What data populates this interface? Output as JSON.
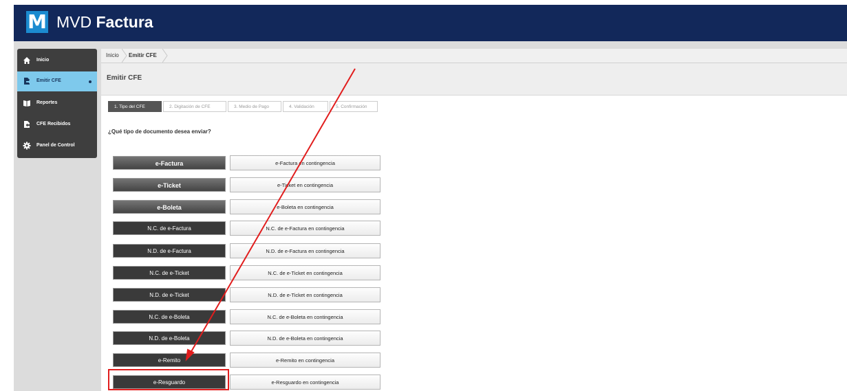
{
  "header": {
    "logo_letter": "M",
    "brand_light": "MVD ",
    "brand_bold": "Factura"
  },
  "sidebar": {
    "items": [
      {
        "label": "Inicio",
        "icon": "home-icon"
      },
      {
        "label": "Emitir CFE",
        "icon": "document-send-icon",
        "active": true
      },
      {
        "label": "Reportes",
        "icon": "book-icon"
      },
      {
        "label": "CFE Recibidos",
        "icon": "document-receive-icon"
      },
      {
        "label": "Panel de Control",
        "icon": "gear-icon"
      }
    ]
  },
  "breadcrumb": {
    "items": [
      "Inicio",
      "Emitir CFE"
    ]
  },
  "page": {
    "title": "Emitir CFE",
    "question": "¿Qué tipo de documento desea enviar?"
  },
  "steps": [
    "1. Tipo del CFE",
    "2. Digitación de CFE",
    "3. Medio de Pago",
    "4. Validación",
    "5. Confirmación"
  ],
  "documents": [
    {
      "type": "e-Factura",
      "contingency": "e-Factura en contingencia"
    },
    {
      "type": "e-Ticket",
      "contingency": "e-Ticket en contingencia"
    },
    {
      "type": "e-Boleta",
      "contingency": "e-Boleta en contingencia"
    },
    {
      "type": "N.C. de e-Factura",
      "contingency": "N.C. de e-Factura en contingencia"
    },
    {
      "type": "N.D. de e-Factura",
      "contingency": "N.D. de e-Factura en contingencia"
    },
    {
      "type": "N.C. de e-Ticket",
      "contingency": "N.C. de e-Ticket en contingencia"
    },
    {
      "type": "N.D. de e-Ticket",
      "contingency": "N.D. de e-Ticket en contingencia"
    },
    {
      "type": "N.C. de e-Boleta",
      "contingency": "N.C. de e-Boleta en contingencia"
    },
    {
      "type": "N.D. de e-Boleta",
      "contingency": "N.D. de e-Boleta en contingencia"
    },
    {
      "type": "e-Remito",
      "contingency": "e-Remito en contingencia"
    },
    {
      "type": "e-Resguardo",
      "contingency": "e-Resguardo en contingencia"
    }
  ],
  "colors": {
    "topbar": "#12285a",
    "accent": "#7ec9ec",
    "annotation": "#e11d1d"
  }
}
